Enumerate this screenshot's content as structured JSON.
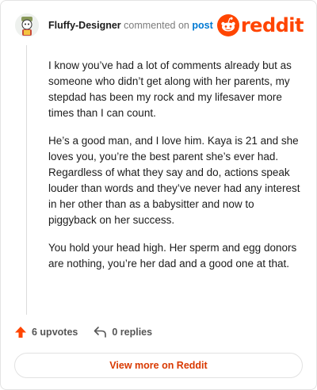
{
  "header": {
    "username": "Fluffy-Designer",
    "action_text": "commented on",
    "post_link": "post",
    "logo_text": "reddit"
  },
  "comment": {
    "paragraphs": [
      "I know you’ve had a lot of comments already but as someone who didn’t get along with her parents, my stepdad has been my rock and my lifesaver more times than I can count.",
      "He’s a good man, and I love him. Kaya is 21 and she loves you, you’re the best parent she’s ever had. Regardless of what they say and do, actions speak louder than words and they’ve never had any interest in her other than as a babysitter and now to piggyback on her success.",
      "You hold your head high. Her sperm and egg donors are nothing, you’re her dad and a good one at that."
    ]
  },
  "actions": {
    "upvotes": "6 upvotes",
    "replies": "0 replies"
  },
  "view_more": {
    "label": "View more on Reddit"
  },
  "colors": {
    "brand": "#ff4500",
    "link": "#0079d3",
    "button_text": "#d93900"
  },
  "icons": {
    "upvote": "upvote-arrow-icon",
    "reply": "reply-arrow-icon",
    "logo": "reddit-snoo-icon"
  }
}
